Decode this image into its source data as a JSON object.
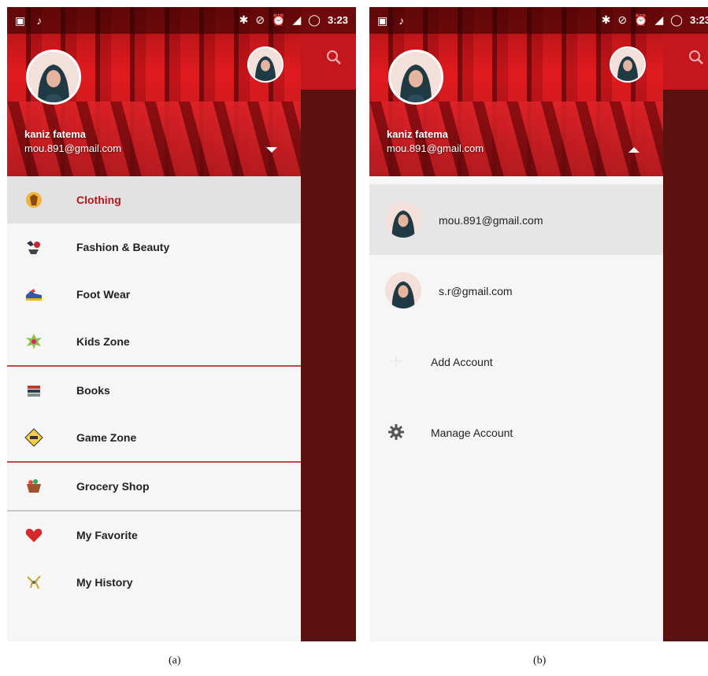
{
  "status_bar": {
    "time": "3:23",
    "left_icons": [
      "image-icon",
      "notification-icon"
    ],
    "right_icons": [
      "bluetooth-icon",
      "do-not-disturb-icon",
      "alarm-icon",
      "lte-signal-icon",
      "battery-ring-icon"
    ]
  },
  "user": {
    "name": "kaniz fatema",
    "email": "mou.891@gmail.com"
  },
  "panel_a": {
    "menu_groups": [
      [
        {
          "label": "Clothing",
          "icon": "clothing-icon",
          "active": true
        },
        {
          "label": "Fashion & Beauty",
          "icon": "fashion-beauty-icon",
          "active": false
        },
        {
          "label": "Foot Wear",
          "icon": "footwear-icon",
          "active": false
        },
        {
          "label": "Kids Zone",
          "icon": "kids-zone-icon",
          "active": false
        }
      ],
      [
        {
          "label": "Books",
          "icon": "books-icon",
          "active": false
        },
        {
          "label": "Game Zone",
          "icon": "game-zone-icon",
          "active": false
        }
      ],
      [
        {
          "label": "Grocery Shop",
          "icon": "grocery-icon",
          "active": false
        }
      ],
      [
        {
          "label": "My Favorite",
          "icon": "heart-icon",
          "active": false
        },
        {
          "label": "My History",
          "icon": "history-icon",
          "active": false
        }
      ]
    ]
  },
  "panel_b": {
    "accounts": [
      {
        "email": "mou.891@gmail.com",
        "active": true
      },
      {
        "email": "s.r@gmail.com",
        "active": false
      }
    ],
    "actions": [
      {
        "label": "Add Account",
        "icon": "add-icon"
      },
      {
        "label": "Manage Account",
        "icon": "gear-icon"
      }
    ]
  },
  "captions": {
    "a": "(a)",
    "b": "(b)"
  },
  "colors": {
    "accent_red": "#c4161c",
    "active_text": "#b5151a",
    "scrim": "#5c1111"
  }
}
